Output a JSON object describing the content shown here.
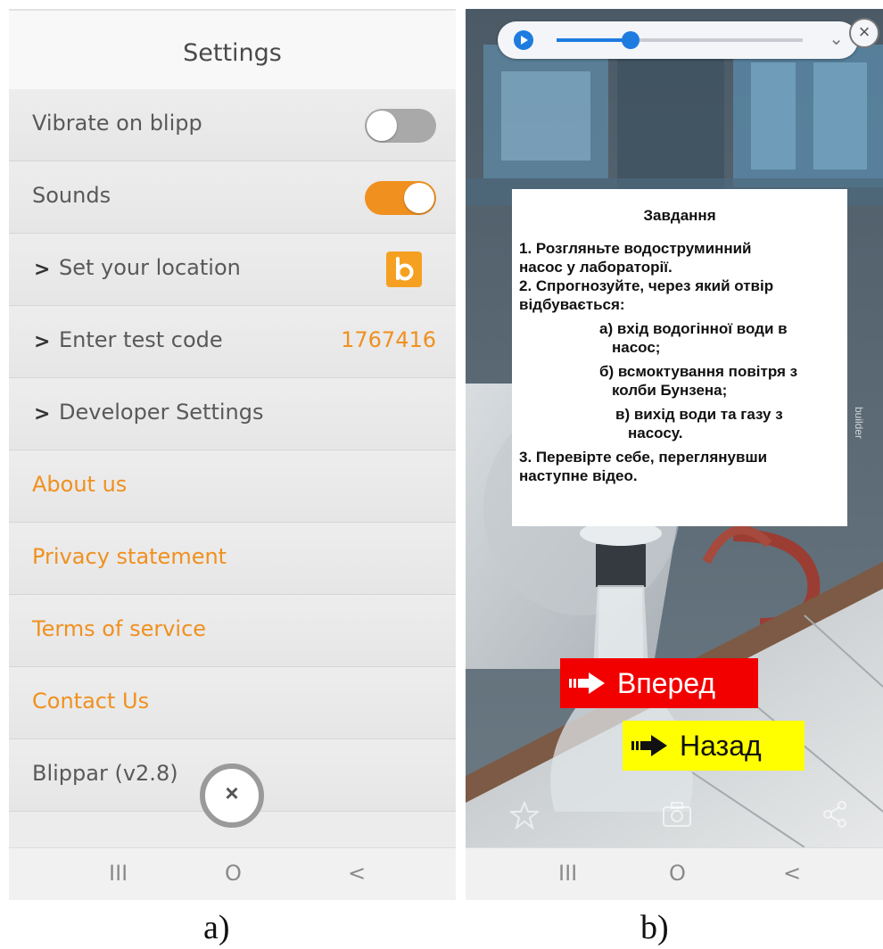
{
  "left_screen": {
    "title": "Settings",
    "rows": [
      {
        "label": "Vibrate on blipp",
        "control": "toggle",
        "state": "off"
      },
      {
        "label": "Sounds",
        "control": "toggle",
        "state": "on"
      },
      {
        "label": "Set your location",
        "control": "chevron-link",
        "icon": "blippar-b-icon"
      },
      {
        "label": "Enter test code",
        "control": "chevron-link",
        "value": "1767416"
      },
      {
        "label": "Developer Settings",
        "control": "chevron-link"
      },
      {
        "label": "About us",
        "control": "link"
      },
      {
        "label": "Privacy statement",
        "control": "link"
      },
      {
        "label": "Terms of service",
        "control": "link"
      },
      {
        "label": "Contact Us",
        "control": "link"
      },
      {
        "label": "Blippar (v2.8)",
        "control": "none"
      }
    ],
    "chevron_glyph": ">",
    "close_glyph": "×",
    "nav_buttons": [
      "III",
      "O",
      "<"
    ]
  },
  "right_screen": {
    "player": {
      "progress": 0.3,
      "chevron_glyph": "⌄",
      "close_glyph": "×"
    },
    "task": {
      "title": "Завдання",
      "lines": [
        "1. Розгляньте водоструминний",
        "насос у лабораторії.",
        "2. Спрогнозуйте, через який отвір",
        "відбувається:",
        "а) вхід водогінної води в",
        "насос;",
        "б) всмоктування повітря з",
        "колби Бунзена;",
        "в) вихід води та газу з",
        "насосу.",
        "3. Перевірте себе, переглянувши",
        "наступне відео."
      ]
    },
    "forward_button": {
      "label": "Вперед",
      "color": "#f20000"
    },
    "back_button": {
      "label": "Назад",
      "color": "#ffff00"
    },
    "bottom_icons": [
      "star-icon",
      "camera-icon",
      "share-icon"
    ],
    "watermark": "builder",
    "nav_buttons": [
      "III",
      "O",
      "<"
    ]
  },
  "captions": {
    "left": "a)",
    "right": "b)"
  },
  "colors": {
    "accent": "#f0901f",
    "toggle_off": "#a9a9a9",
    "player_blue": "#1e7be0"
  }
}
